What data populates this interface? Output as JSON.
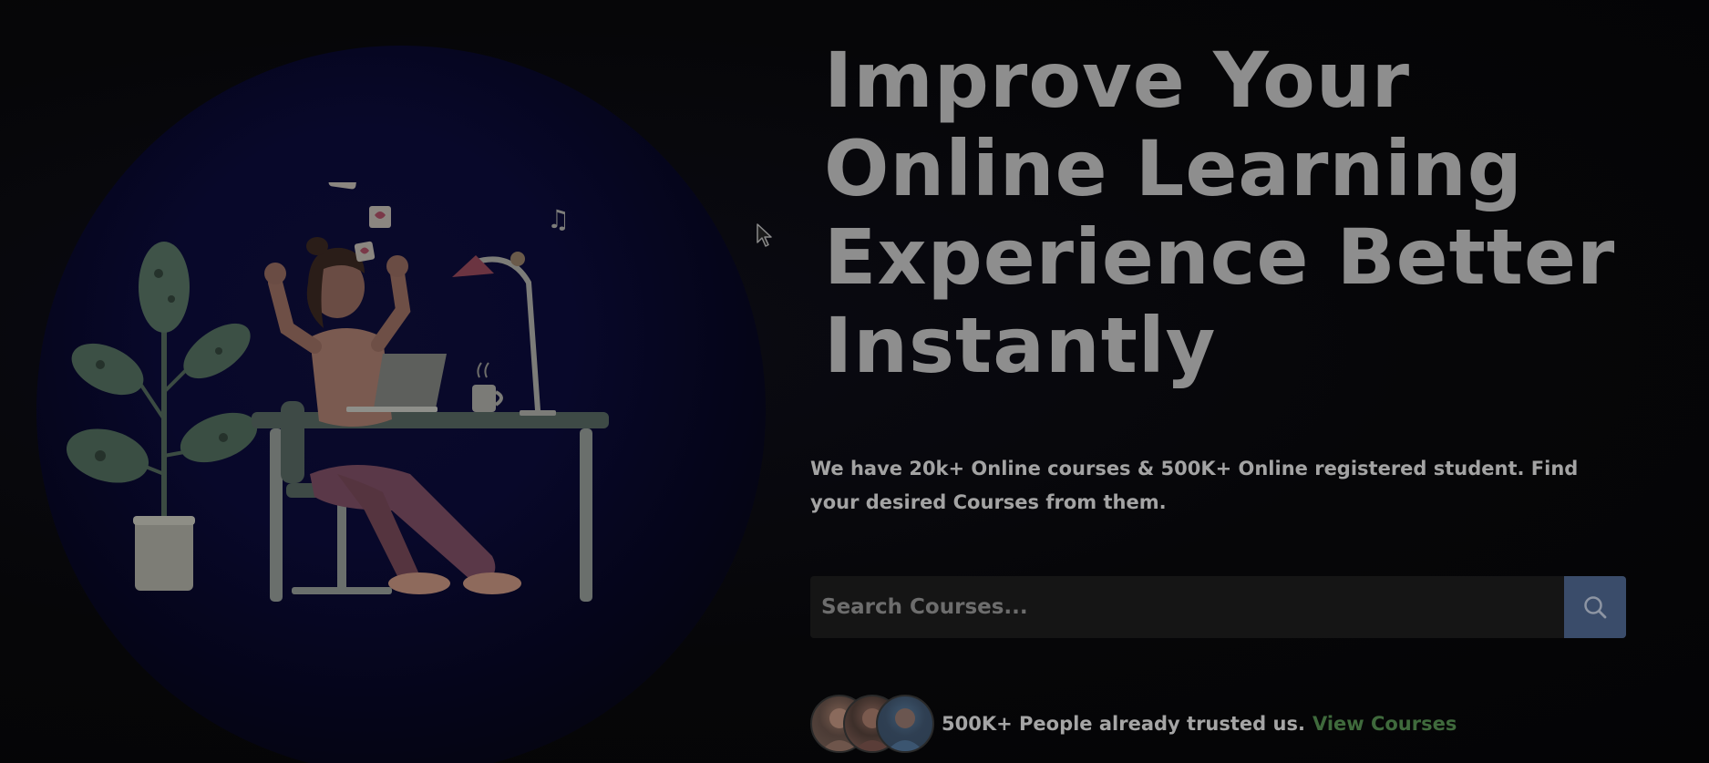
{
  "hero": {
    "headline_lines": [
      "Improve Your",
      "Online Learning",
      "Experience Better",
      "Instantly"
    ],
    "subtitle": "We have 20k+ Online courses & 500K+ Online registered student. Find your desired Courses from them.",
    "search": {
      "placeholder": "Search Courses...",
      "value": "",
      "button_icon": "search-icon"
    },
    "trust": {
      "text": "500K+ People already trusted us.",
      "link_label": "View Courses"
    }
  },
  "colors": {
    "background": "#050507",
    "headline": "#8e8e8e",
    "search_button": "#3a4c6a",
    "link": "#3f6a3c"
  },
  "icons": {
    "search": "search-icon",
    "cursor": "mouse-pointer-icon"
  }
}
